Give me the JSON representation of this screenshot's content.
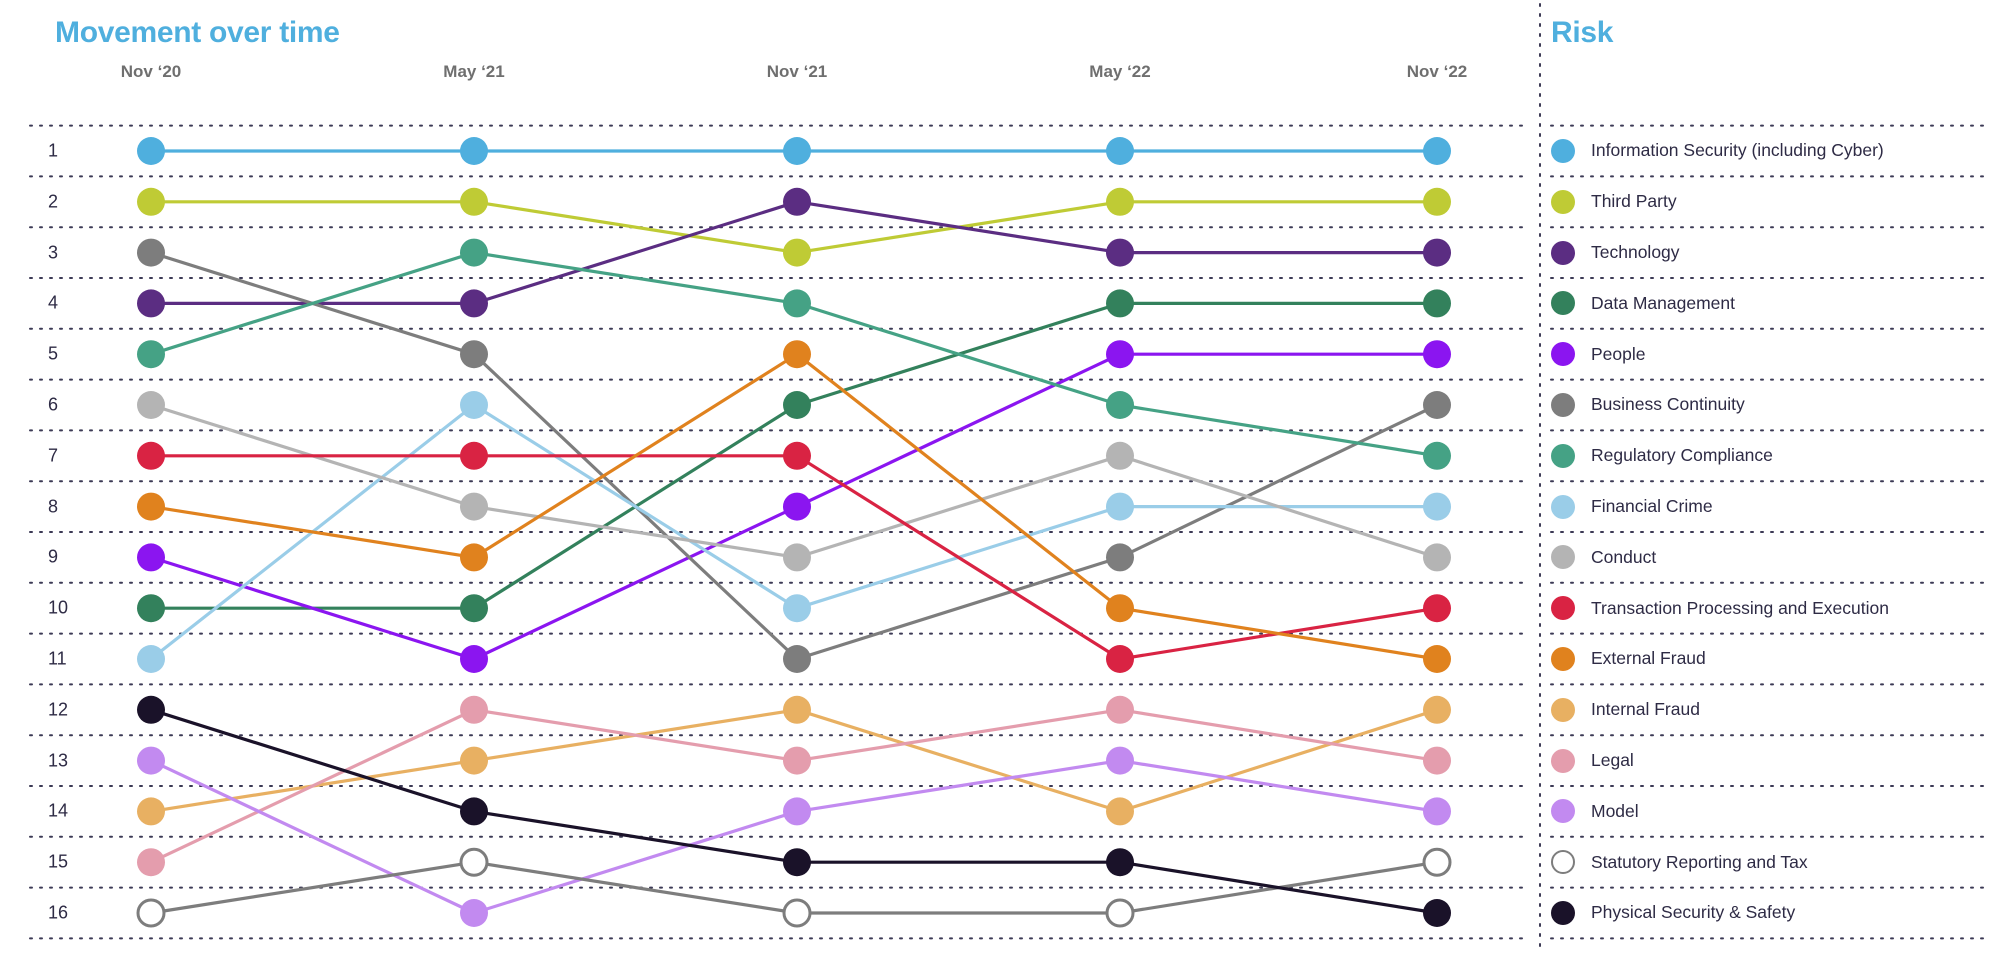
{
  "header": {
    "chart_title": "Movement over time",
    "risk_title": "Risk"
  },
  "chart_data": {
    "type": "line",
    "subtype": "bump-chart",
    "title": "Movement over time",
    "xlabel": "",
    "ylabel": "",
    "categories": [
      "Nov ‘20",
      "May ‘21",
      "Nov ‘21",
      "May ‘22",
      "Nov ‘22"
    ],
    "rank_labels": [
      "1",
      "2",
      "3",
      "4",
      "5",
      "6",
      "7",
      "8",
      "9",
      "10",
      "11",
      "12",
      "13",
      "14",
      "15",
      "16"
    ],
    "ylim": [
      1,
      16
    ],
    "y_inverted": true,
    "grid": "horizontal-dotted",
    "legend_position": "right",
    "legend_title": "Risk",
    "series": [
      {
        "name": "Information Security (including Cyber)",
        "color": "#4FAFDE",
        "outline": false,
        "values": [
          1,
          1,
          1,
          1,
          1
        ]
      },
      {
        "name": "Third Party",
        "color": "#BFCB35",
        "outline": false,
        "values": [
          2,
          2,
          3,
          2,
          2
        ]
      },
      {
        "name": "Technology",
        "color": "#5B2D82",
        "outline": false,
        "values": [
          4,
          4,
          2,
          3,
          3
        ]
      },
      {
        "name": "Data Management",
        "color": "#33815C",
        "outline": false,
        "values": [
          10,
          10,
          6,
          4,
          4
        ]
      },
      {
        "name": "People",
        "color": "#8B15F0",
        "outline": false,
        "values": [
          9,
          11,
          8,
          5,
          5
        ]
      },
      {
        "name": "Business Continuity",
        "color": "#7D7D7D",
        "outline": false,
        "values": [
          3,
          5,
          11,
          9,
          6
        ]
      },
      {
        "name": "Regulatory Compliance",
        "color": "#45A285",
        "outline": false,
        "values": [
          5,
          3,
          4,
          6,
          7
        ]
      },
      {
        "name": "Financial Crime",
        "color": "#9ACDE8",
        "outline": false,
        "values": [
          11,
          6,
          10,
          8,
          8
        ]
      },
      {
        "name": "Conduct",
        "color": "#B4B4B4",
        "outline": false,
        "values": [
          6,
          8,
          9,
          7,
          9
        ]
      },
      {
        "name": "Transaction Processing and Execution",
        "color": "#D92343",
        "outline": false,
        "values": [
          7,
          7,
          7,
          11,
          10
        ]
      },
      {
        "name": "External Fraud",
        "color": "#E0821E",
        "outline": false,
        "values": [
          8,
          9,
          5,
          10,
          11
        ]
      },
      {
        "name": "Internal Fraud",
        "color": "#E8B062",
        "outline": false,
        "values": [
          14,
          13,
          12,
          14,
          12
        ]
      },
      {
        "name": "Legal",
        "color": "#E49DAD",
        "outline": false,
        "values": [
          15,
          12,
          13,
          12,
          13
        ]
      },
      {
        "name": "Model",
        "color": "#C28AF0",
        "outline": false,
        "values": [
          13,
          16,
          14,
          13,
          14
        ]
      },
      {
        "name": "Statutory Reporting and Tax",
        "color": "#FFFFFF",
        "outline": true,
        "outline_color": "#7D7D7D",
        "values": [
          16,
          15,
          16,
          16,
          15
        ]
      },
      {
        "name": "Physical Security & Safety",
        "color": "#1A1229",
        "outline": false,
        "values": [
          12,
          14,
          15,
          15,
          16
        ]
      }
    ]
  },
  "legend": {
    "items": [
      {
        "label": "Information Security (including Cyber)",
        "color": "#4FAFDE",
        "outline": false
      },
      {
        "label": "Third Party",
        "color": "#BFCB35",
        "outline": false
      },
      {
        "label": "Technology",
        "color": "#5B2D82",
        "outline": false
      },
      {
        "label": "Data Management",
        "color": "#33815C",
        "outline": false
      },
      {
        "label": "People",
        "color": "#8B15F0",
        "outline": false
      },
      {
        "label": "Business Continuity",
        "color": "#7D7D7D",
        "outline": false
      },
      {
        "label": "Regulatory Compliance",
        "color": "#45A285",
        "outline": false
      },
      {
        "label": "Financial Crime",
        "color": "#9ACDE8",
        "outline": false
      },
      {
        "label": "Conduct",
        "color": "#B4B4B4",
        "outline": false
      },
      {
        "label": "Transaction Processing and Execution",
        "color": "#D92343",
        "outline": false
      },
      {
        "label": "External Fraud",
        "color": "#E0821E",
        "outline": false
      },
      {
        "label": "Internal Fraud",
        "color": "#E8B062",
        "outline": false
      },
      {
        "label": "Legal",
        "color": "#E49DAD",
        "outline": false
      },
      {
        "label": "Model",
        "color": "#C28AF0",
        "outline": false
      },
      {
        "label": "Statutory Reporting and Tax",
        "color": "#FFFFFF",
        "outline": true
      },
      {
        "label": "Physical Security & Safety",
        "color": "#1A1229",
        "outline": false
      }
    ]
  },
  "style": {
    "accent": "#4FAFDE",
    "text": "#2E2B45",
    "muted_text": "#6F6F6F",
    "gridline": "#3C3A55",
    "background": "#FFFFFF"
  }
}
